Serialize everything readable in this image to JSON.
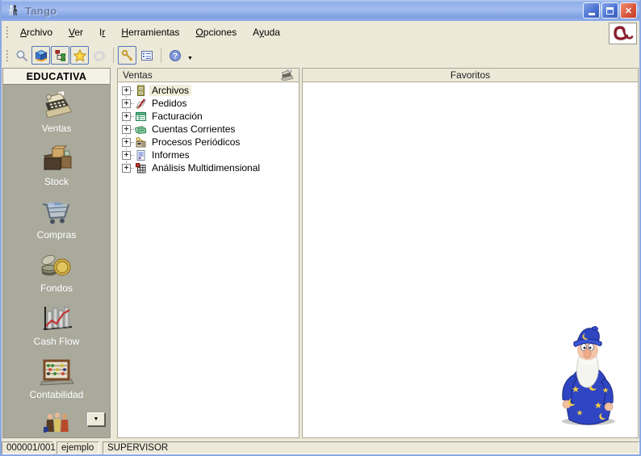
{
  "window": {
    "title": "Tango"
  },
  "menu_bar": {
    "items": [
      {
        "label": "Archivo",
        "underline": 0
      },
      {
        "label": "Ver",
        "underline": 0
      },
      {
        "label": "Ir",
        "underline": 1
      },
      {
        "label": "Herramientas",
        "underline": 0
      },
      {
        "label": "Opciones",
        "underline": 0
      },
      {
        "label": "Ayuda",
        "underline": 1
      }
    ]
  },
  "toolbar": {
    "buttons": [
      {
        "name": "search",
        "icon": "magnifier-icon",
        "toggled": false,
        "disabled": false
      },
      {
        "name": "modules-view",
        "icon": "cube-3d-icon",
        "toggled": true,
        "disabled": false
      },
      {
        "name": "tree-view",
        "icon": "tree-hierarchy-icon",
        "toggled": true,
        "disabled": false
      },
      {
        "name": "favorites-view",
        "icon": "star-icon",
        "toggled": true,
        "disabled": false
      },
      {
        "name": "ring",
        "icon": "ring-icon",
        "toggled": false,
        "disabled": true
      },
      {
        "name": "access-key",
        "icon": "key-icon",
        "toggled": true,
        "disabled": false
      },
      {
        "name": "details-list",
        "icon": "list-icon",
        "toggled": false,
        "disabled": false
      },
      {
        "name": "help",
        "icon": "help-icon",
        "toggled": false,
        "disabled": false
      }
    ]
  },
  "sidebar": {
    "header": "EDUCATIVA",
    "modules": [
      {
        "label": "Ventas",
        "icon": "cash-register-icon"
      },
      {
        "label": "Stock",
        "icon": "boxes-icon"
      },
      {
        "label": "Compras",
        "icon": "shopping-cart-icon"
      },
      {
        "label": "Fondos",
        "icon": "coins-icon"
      },
      {
        "label": "Cash Flow",
        "icon": "chart-icon"
      },
      {
        "label": "Contabilidad",
        "icon": "abacus-icon"
      }
    ],
    "partial_module_icon": "people-icon"
  },
  "tree_panel": {
    "header": "Ventas",
    "header_icon": "cash-register-small-icon",
    "items": [
      {
        "label": "Archivos",
        "icon": "archives-icon",
        "selected": true
      },
      {
        "label": "Pedidos",
        "icon": "orders-icon",
        "selected": false
      },
      {
        "label": "Facturación",
        "icon": "invoicing-icon",
        "selected": false
      },
      {
        "label": "Cuentas Corrientes",
        "icon": "accounts-icon",
        "selected": false
      },
      {
        "label": "Procesos Periódicos",
        "icon": "periodic-processes-icon",
        "selected": false
      },
      {
        "label": "Informes",
        "icon": "reports-icon",
        "selected": false
      },
      {
        "label": "Análisis Multidimensional",
        "icon": "multidimensional-icon",
        "selected": false
      }
    ]
  },
  "favorites_panel": {
    "header": "Favoritos",
    "assistant": "merlin-wizard"
  },
  "status_bar": {
    "company": "000001/001",
    "database": "ejemplo",
    "user": "SUPERVISOR"
  },
  "colors": {
    "titlebar_top": "#a3bcee",
    "titlebar_bottom": "#7e9fe2",
    "window_bg": "#ece9d8",
    "sidebar_bg": "#a9a99c",
    "sidebar_header_bg": "#f4f2e6",
    "panel_border": "#aca899",
    "tree_selection_bg": "#f0eedb",
    "close_button": "#d8533a",
    "logo_red": "#8a2030"
  }
}
